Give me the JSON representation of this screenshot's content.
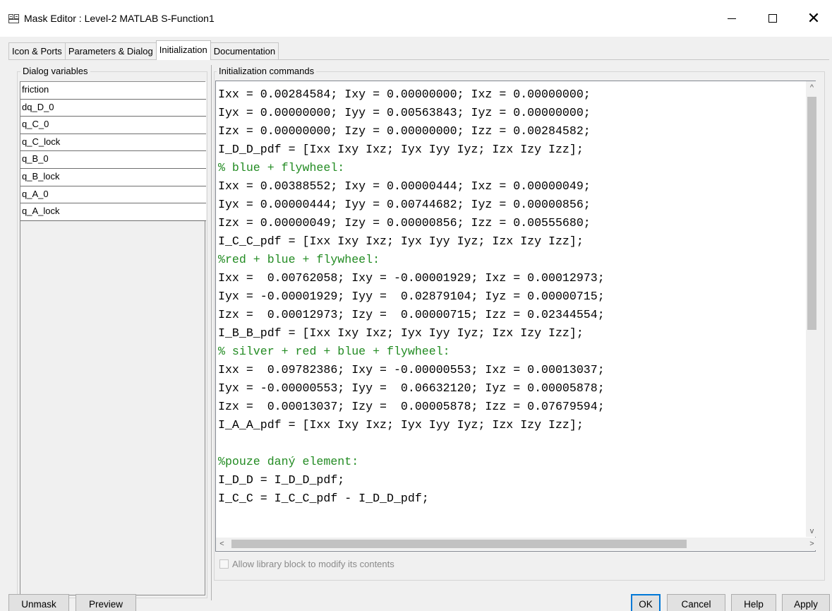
{
  "window": {
    "title": "Mask Editor : Level-2 MATLAB S-Function1",
    "app_icon": "mask-editor-icon",
    "controls": {
      "minimize": "—",
      "maximize": "☐",
      "close": "✕"
    }
  },
  "tabs": [
    {
      "label": "Icon & Ports",
      "active": false
    },
    {
      "label": "Parameters & Dialog",
      "active": false
    },
    {
      "label": "Initialization",
      "active": true
    },
    {
      "label": "Documentation",
      "active": false
    }
  ],
  "dialog_variables": {
    "label": "Dialog variables",
    "items": [
      "friction",
      "dq_D_0",
      "q_C_0",
      "q_C_lock",
      "q_B_0",
      "q_B_lock",
      "q_A_0",
      "q_A_lock"
    ]
  },
  "initialization": {
    "label": "Initialization commands",
    "lines": [
      {
        "text": "Ixx = 0.00284584; Ixy = 0.00000000; Ixz = 0.00000000;",
        "comment": false
      },
      {
        "text": "Iyx = 0.00000000; Iyy = 0.00563843; Iyz = 0.00000000;",
        "comment": false
      },
      {
        "text": "Izx = 0.00000000; Izy = 0.00000000; Izz = 0.00284582;",
        "comment": false
      },
      {
        "text": "I_D_D_pdf = [Ixx Ixy Ixz; Iyx Iyy Iyz; Izx Izy Izz];",
        "comment": false
      },
      {
        "text": "% blue + flywheel:",
        "comment": true
      },
      {
        "text": "Ixx = 0.00388552; Ixy = 0.00000444; Ixz = 0.00000049;",
        "comment": false
      },
      {
        "text": "Iyx = 0.00000444; Iyy = 0.00744682; Iyz = 0.00000856;",
        "comment": false
      },
      {
        "text": "Izx = 0.00000049; Izy = 0.00000856; Izz = 0.00555680;",
        "comment": false
      },
      {
        "text": "I_C_C_pdf = [Ixx Ixy Ixz; Iyx Iyy Iyz; Izx Izy Izz];",
        "comment": false
      },
      {
        "text": "%red + blue + flywheel:",
        "comment": true
      },
      {
        "text": "Ixx =  0.00762058; Ixy = -0.00001929; Ixz = 0.00012973;",
        "comment": false
      },
      {
        "text": "Iyx = -0.00001929; Iyy =  0.02879104; Iyz = 0.00000715;",
        "comment": false
      },
      {
        "text": "Izx =  0.00012973; Izy =  0.00000715; Izz = 0.02344554;",
        "comment": false
      },
      {
        "text": "I_B_B_pdf = [Ixx Ixy Ixz; Iyx Iyy Iyz; Izx Izy Izz];",
        "comment": false
      },
      {
        "text": "% silver + red + blue + flywheel:",
        "comment": true
      },
      {
        "text": "Ixx =  0.09782386; Ixy = -0.00000553; Ixz = 0.00013037;",
        "comment": false
      },
      {
        "text": "Iyx = -0.00000553; Iyy =  0.06632120; Iyz = 0.00005878;",
        "comment": false
      },
      {
        "text": "Izx =  0.00013037; Izy =  0.00005878; Izz = 0.07679594;",
        "comment": false
      },
      {
        "text": "I_A_A_pdf = [Ixx Ixy Ixz; Iyx Iyy Iyz; Izx Izy Izz];",
        "comment": false
      },
      {
        "text": "",
        "comment": false
      },
      {
        "text": "%pouze daný element:",
        "comment": true
      },
      {
        "text": "I_D_D = I_D_D_pdf;",
        "comment": false
      },
      {
        "text": "I_C_C = I_C_C_pdf - I_D_D_pdf;",
        "comment": false
      }
    ],
    "scroll": {
      "up": "^",
      "down": "v",
      "left": "<",
      "right": ">"
    }
  },
  "checkbox": {
    "label": "Allow library block to modify its contents",
    "checked": false,
    "enabled": false
  },
  "buttons": {
    "unmask": "Unmask",
    "preview": "Preview",
    "ok": "OK",
    "cancel": "Cancel",
    "help": "Help",
    "apply": "Apply"
  },
  "colors": {
    "comment": "#228b22",
    "background": "#f0f0f0",
    "focus": "#0078d7"
  }
}
